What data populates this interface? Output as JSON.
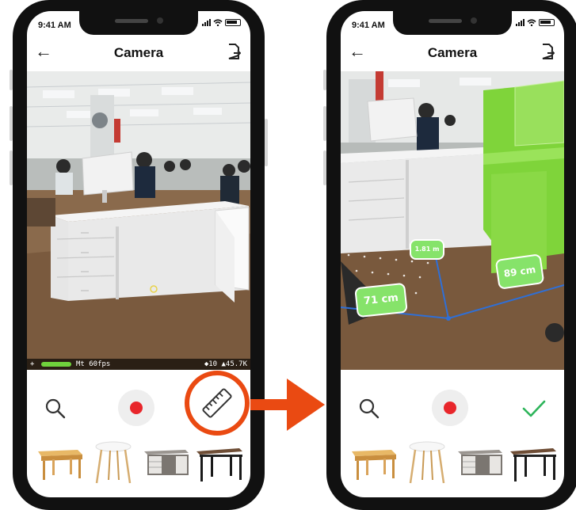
{
  "status": {
    "time": "9:41 AM"
  },
  "appbar": {
    "title": "Camera",
    "back_icon": "arrow-left-icon",
    "share_icon": "file-export-icon"
  },
  "ar_overlay": {
    "fps_label": "Mt 60fps",
    "plus": "+",
    "stats": "◆10 ▲45.7K"
  },
  "toolbar_left": {
    "search_icon": "search-icon",
    "record_icon": "record-icon",
    "measure_icon": "ruler-icon"
  },
  "toolbar_right": {
    "search_icon": "search-icon",
    "record_icon": "record-icon",
    "confirm_icon": "check-icon"
  },
  "measurements": {
    "width": "71 cm",
    "depth": "89 cm",
    "height": "1.81 m"
  },
  "furniture": [
    "wooden-table",
    "round-white-table",
    "grey-desk-with-drawers",
    "black-frame-desk"
  ],
  "colors": {
    "highlight": "#ea4a12",
    "record": "#e8262b",
    "confirm": "#2db45a",
    "ar_green": "#86e36a"
  }
}
